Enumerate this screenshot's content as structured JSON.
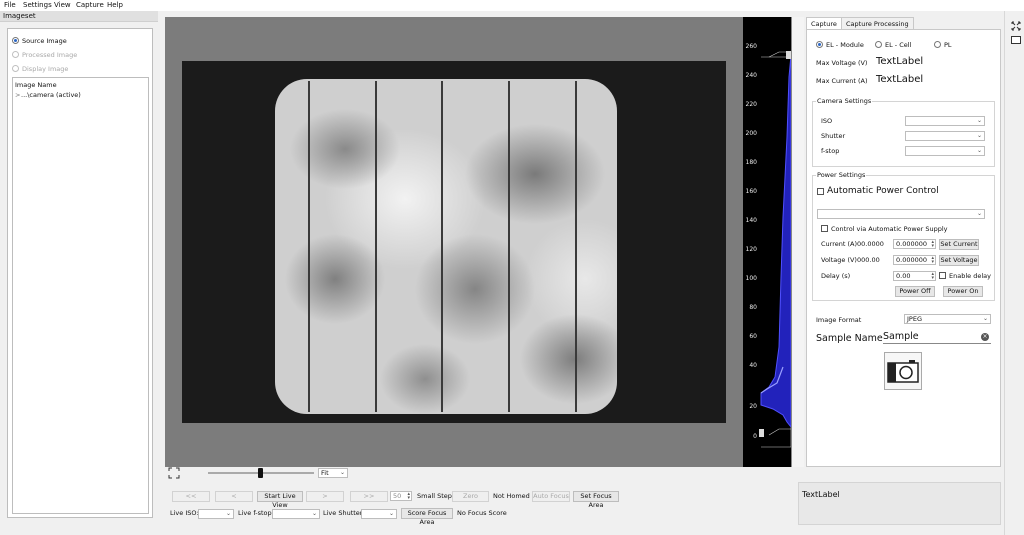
{
  "menu": [
    "File",
    "Settings",
    "View",
    "Capture",
    "Help"
  ],
  "left": {
    "title": "Imageset",
    "radios": [
      {
        "label": "Source Image",
        "selected": true,
        "enabled": true
      },
      {
        "label": "Processed Image",
        "selected": false,
        "enabled": false
      },
      {
        "label": "Display Image",
        "selected": false,
        "enabled": false
      }
    ],
    "tree_header": "Image Name",
    "tree_item": "...\\camera (active)",
    "tree_expander": ">"
  },
  "histogram": {
    "ticks": [
      "260",
      "240",
      "220",
      "200",
      "180",
      "160",
      "140",
      "120",
      "100",
      "80",
      "60",
      "40",
      "20",
      "0"
    ],
    "line_color": "#3030ff"
  },
  "viewer": {
    "zoom_value": "Fit",
    "fit_icon": "expand-corners-icon"
  },
  "controls": {
    "first": "<<",
    "prev": "<",
    "start_live_view": "Start Live View",
    "next": ">",
    "last": ">>",
    "step_value": "50",
    "small_step": "Small Step",
    "zero": "Zero",
    "not_homed": "Not Homed",
    "auto_focus": "Auto Focus",
    "set_focus_area": "Set Focus Area",
    "live_iso": "Live ISO:",
    "live_fstop": "Live f-stop",
    "live_shutter": "Live Shutter:",
    "score_focus_area": "Score Focus Area",
    "no_focus_score": "No Focus Score"
  },
  "right": {
    "tabs": [
      "Capture",
      "Capture Processing"
    ],
    "modes": [
      {
        "label": "EL - Module",
        "selected": true
      },
      {
        "label": "EL - Cell",
        "selected": false
      },
      {
        "label": "PL",
        "selected": false
      }
    ],
    "max_voltage_label": "Max Voltage (V)",
    "max_voltage_value": "TextLabel",
    "max_current_label": "Max Current (A)",
    "max_current_value": "TextLabel",
    "camera_settings": {
      "title": "Camera Settings",
      "iso": "ISO",
      "shutter": "Shutter",
      "fstop": "f-stop"
    },
    "power_settings": {
      "title": "Power Settings",
      "auto_power": "Automatic Power Control",
      "control_via": "Control via Automatic Power Supply",
      "current_label": "Current (A)",
      "current_read": "00.0000",
      "current_value": "0.000000",
      "set_current": "Set Current",
      "voltage_label": "Voltage (V)",
      "voltage_read": "000.00",
      "voltage_value": "0.000000",
      "set_voltage": "Set Voltage",
      "delay_label": "Delay (s)",
      "delay_value": "0.00",
      "enable_delay": "Enable delay",
      "power_off": "Power Off",
      "power_on": "Power On"
    },
    "image_format_label": "Image Format",
    "image_format_value": "JPEG",
    "sample_name_label": "Sample Name",
    "sample_name_value": "Sample",
    "capture_icon": "camera-icon"
  },
  "bottom_label": "TextLabel",
  "side_icons": [
    "expand-arrows-icon",
    "screen-icon"
  ]
}
